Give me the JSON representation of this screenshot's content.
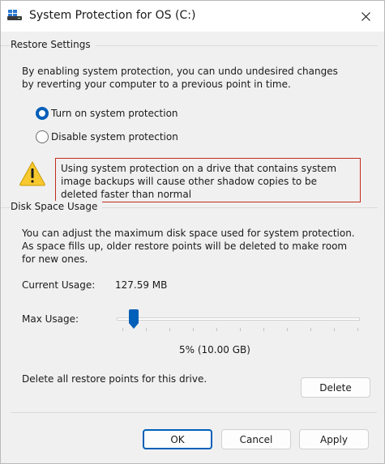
{
  "window": {
    "title": "System Protection for OS (C:)",
    "accent_color": "#005fb8",
    "warning_border_color": "#c42b1c"
  },
  "restore_settings": {
    "group_label": "Restore Settings",
    "description": "By enabling system protection, you can undo undesired changes by reverting your computer to a previous point in time.",
    "options": [
      {
        "label": "Turn on system protection",
        "selected": true
      },
      {
        "label": "Disable system protection",
        "selected": false
      }
    ],
    "warning_icon": "warning-triangle-icon",
    "warning_text": "Using system protection on a drive that contains system image backups will cause other shadow copies to be deleted faster than normal"
  },
  "disk_space": {
    "group_label": "Disk Space Usage",
    "description": "You can adjust the maximum disk space used for system protection. As space fills up, older restore points will be deleted to make room for new ones.",
    "current_usage_label": "Current Usage:",
    "current_usage_value": "127.59 MB",
    "max_usage_label": "Max Usage:",
    "max_usage_percent": 5,
    "max_usage_value": "5% (10.00 GB)",
    "delete_text": "Delete all restore points for this drive.",
    "delete_button": "Delete"
  },
  "footer": {
    "ok": "OK",
    "cancel": "Cancel",
    "apply": "Apply"
  }
}
